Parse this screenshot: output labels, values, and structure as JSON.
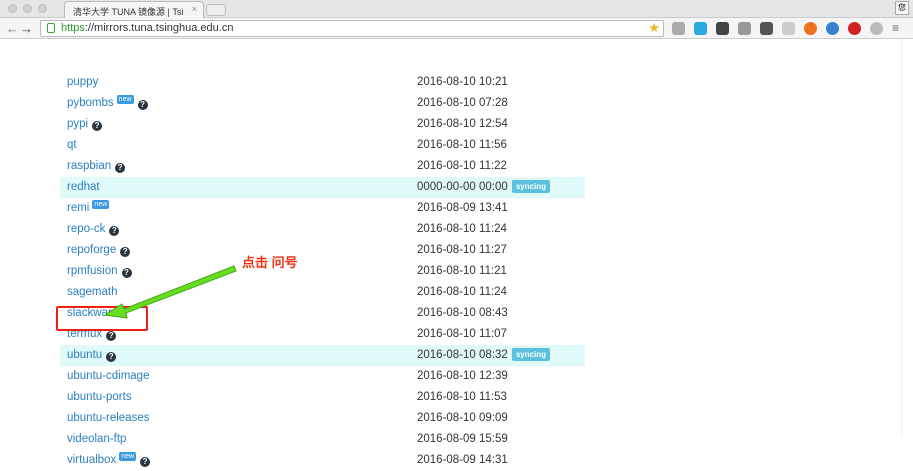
{
  "browser": {
    "tab_title": "清华大学 TUNA 镜像源 | Tsi",
    "url_scheme": "https",
    "url_rest": "://mirrors.tuna.tsinghua.edu.cn",
    "user_label": "您"
  },
  "rows": [
    {
      "name": "puppy",
      "help": false,
      "new": false,
      "date": "2016-08-10 10:21",
      "status": ""
    },
    {
      "name": "pybombs",
      "help": true,
      "new": true,
      "date": "2016-08-10 07:28",
      "status": ""
    },
    {
      "name": "pypi",
      "help": true,
      "new": false,
      "date": "2016-08-10 12:54",
      "status": ""
    },
    {
      "name": "qt",
      "help": false,
      "new": false,
      "date": "2016-08-10 11:56",
      "status": ""
    },
    {
      "name": "raspbian",
      "help": true,
      "new": false,
      "date": "2016-08-10 11:22",
      "status": ""
    },
    {
      "name": "redhat",
      "help": false,
      "new": false,
      "date": "0000-00-00 00:00",
      "status": "syncing"
    },
    {
      "name": "remi",
      "help": false,
      "new": true,
      "date": "2016-08-09 13:41",
      "status": ""
    },
    {
      "name": "repo-ck",
      "help": true,
      "new": false,
      "date": "2016-08-10 11:24",
      "status": ""
    },
    {
      "name": "repoforge",
      "help": true,
      "new": false,
      "date": "2016-08-10 11:27",
      "status": ""
    },
    {
      "name": "rpmfusion",
      "help": true,
      "new": false,
      "date": "2016-08-10 11:21",
      "status": ""
    },
    {
      "name": "sagemath",
      "help": false,
      "new": false,
      "date": "2016-08-10 11:24",
      "status": ""
    },
    {
      "name": "slackware",
      "help": false,
      "new": false,
      "date": "2016-08-10 08:43",
      "status": ""
    },
    {
      "name": "termux",
      "help": true,
      "new": false,
      "date": "2016-08-10 11:07",
      "status": ""
    },
    {
      "name": "ubuntu",
      "help": true,
      "new": false,
      "date": "2016-08-10 08:32",
      "status": "syncing"
    },
    {
      "name": "ubuntu-cdimage",
      "help": false,
      "new": false,
      "date": "2016-08-10 12:39",
      "status": ""
    },
    {
      "name": "ubuntu-ports",
      "help": false,
      "new": false,
      "date": "2016-08-10 11:53",
      "status": ""
    },
    {
      "name": "ubuntu-releases",
      "help": false,
      "new": false,
      "date": "2016-08-10 09:09",
      "status": ""
    },
    {
      "name": "videolan-ftp",
      "help": false,
      "new": false,
      "date": "2016-08-09 15:59",
      "status": ""
    },
    {
      "name": "virtualbox",
      "help": true,
      "new": true,
      "date": "2016-08-09 14:31",
      "status": ""
    }
  ],
  "labels": {
    "new": "new",
    "help": "?"
  },
  "annotation": {
    "text": "点击  问号"
  }
}
